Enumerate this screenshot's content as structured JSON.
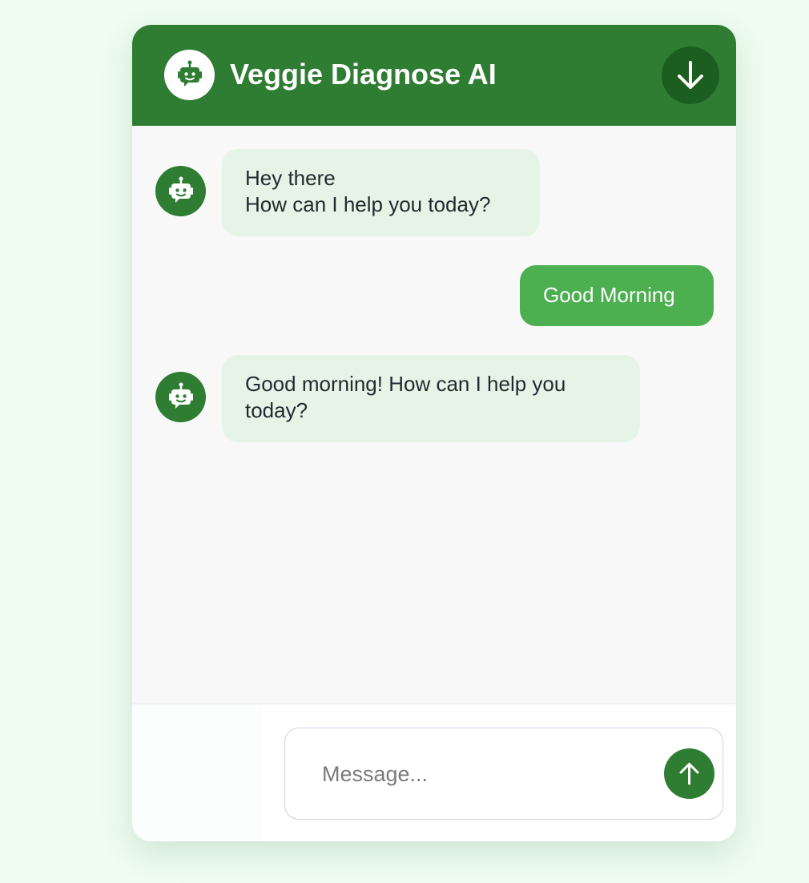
{
  "header": {
    "title": "Veggie Diagnose AI",
    "avatar_icon": "chatbot-icon",
    "minimize_icon": "arrow-down-icon"
  },
  "messages": [
    {
      "role": "bot",
      "text": "Hey there\nHow can I help you today?"
    },
    {
      "role": "user",
      "text": "Good Morning"
    },
    {
      "role": "bot",
      "text": "Good morning! How can I help you today?"
    }
  ],
  "composer": {
    "placeholder": "Message...",
    "send_icon": "arrow-up-icon"
  },
  "colors": {
    "primary": "#2e7d32",
    "primary_dark": "#1b5e20",
    "user_bubble": "#4caf50",
    "bot_bubble": "#e6f4e7",
    "page_background": "#effcf1"
  }
}
